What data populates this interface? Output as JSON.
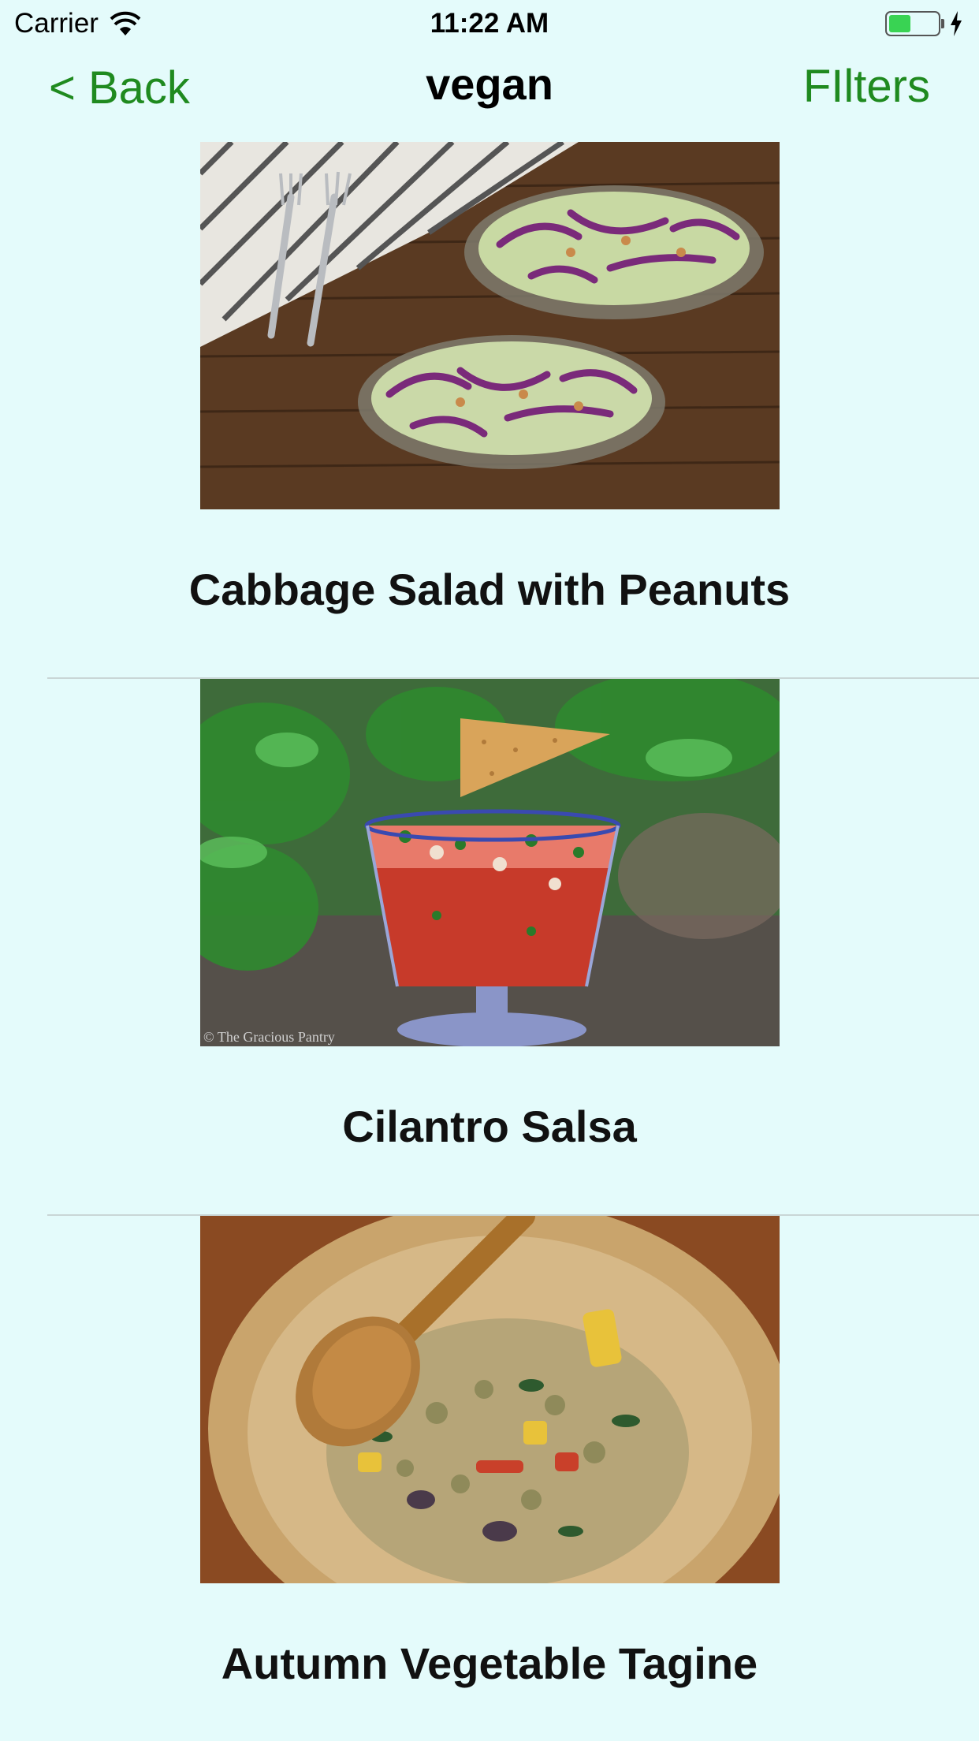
{
  "status_bar": {
    "carrier": "Carrier",
    "time": "11:22 AM",
    "battery_level": 0.45
  },
  "nav": {
    "back_label": "< Back",
    "title": "vegan",
    "filters_label": "FIlters"
  },
  "recipes": [
    {
      "title": "Cabbage Salad with Peanuts"
    },
    {
      "title": "Cilantro Salsa",
      "image_watermark": "© The Gracious Pantry"
    },
    {
      "title": "Autumn Vegetable Tagine"
    }
  ],
  "colors": {
    "background": "#e4fbfb",
    "accent": "#1f8a1f",
    "battery": "#39d353"
  }
}
